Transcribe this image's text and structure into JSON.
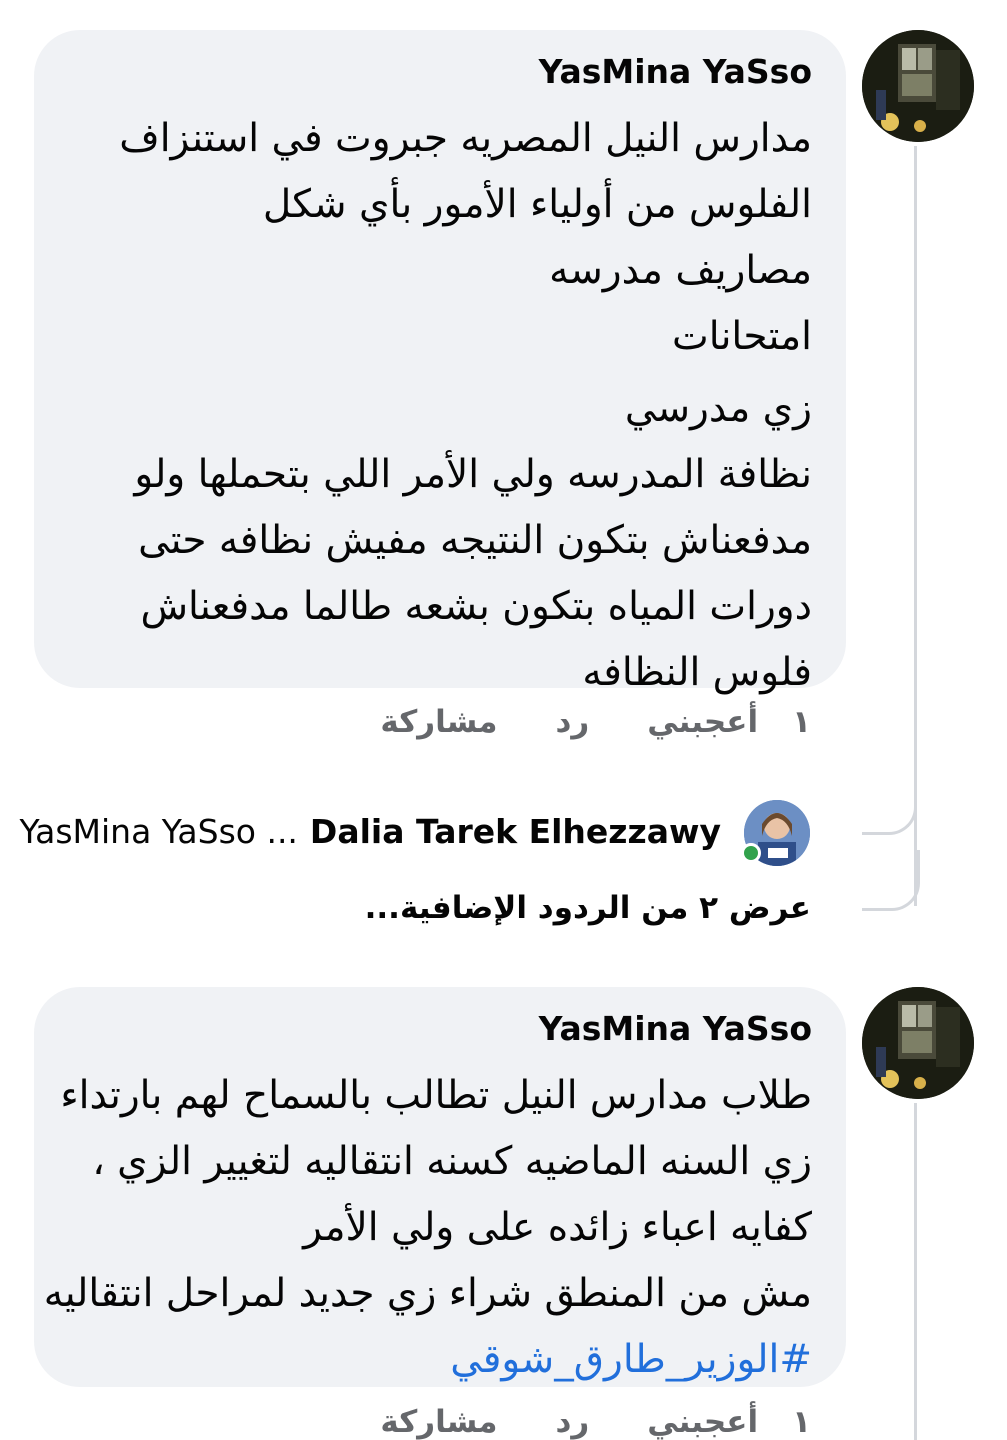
{
  "comments": [
    {
      "author": "YasMina YaSso",
      "lines": [
        "مدارس النيل المصريه جبروت في استنزاف",
        "الفلوس من أولياء الأمور بأي شكل",
        "مصاريف مدرسه",
        "امتحانات",
        "زي مدرسي",
        "نظافة المدرسه ولي الأمر اللي بتحملها ولو",
        "مدفعناش بتكون النتيجه مفيش نظافه حتى",
        "دورات المياه بتكون بشعه طالما مدفعناش",
        "فلوس النظافه"
      ],
      "actions": {
        "count": "١",
        "like": "أعجبني",
        "reply": "رد",
        "share": "مشاركة"
      }
    },
    {
      "author": "YasMina YaSso",
      "lines": [
        "طلاب مدارس النيل تطالب بالسماح لهم بارتداء",
        "زي السنه الماضيه كسنه انتقاليه لتغيير الزي ،",
        "كفايه اعباء زائده على ولي الأمر",
        "مش من المنطق شراء زي جديد لمراحل انتقاليه"
      ],
      "hashtag": "#الوزير_طارق_شوقي",
      "actions": {
        "count": "١",
        "like": "أعجبني",
        "reply": "رد",
        "share": "مشاركة"
      }
    }
  ],
  "reply_preview": {
    "name": "Dalia Tarek Elhezzawy",
    "text": "YasMina YaSso ..."
  },
  "more_replies": "عرض ٢ من الردود الإضافية...",
  "colors": {
    "bubble": "#f0f2f5",
    "secondary_text": "#65676b",
    "hashtag": "#216fdb",
    "online": "#31a24c"
  }
}
